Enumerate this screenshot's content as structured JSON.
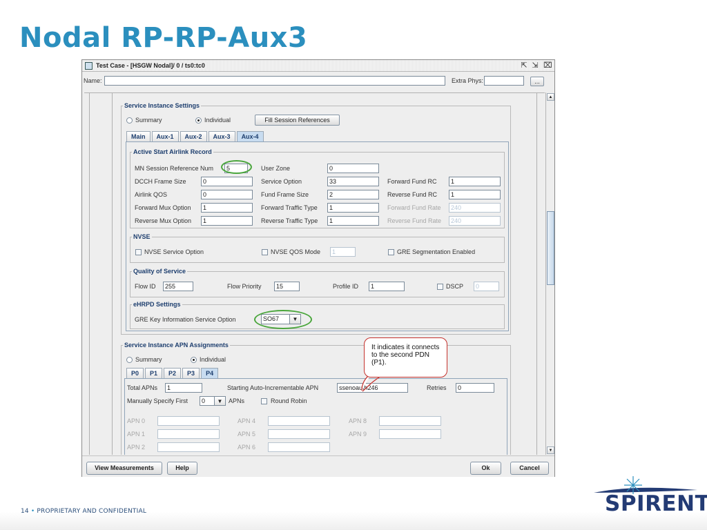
{
  "slide": {
    "title": "Nodal RP-RP-Aux3",
    "footer_page": "14",
    "footer_text": "PROPRIETARY AND CONFIDENTIAL",
    "logo_text": "SPIRENT"
  },
  "window": {
    "title": "Test Case - [HSGW Nodal]/ 0 / ts0:tc0",
    "name_label": "Name:",
    "name_value": "",
    "extra_phys_label": "Extra Phys:",
    "extra_phys_value": "",
    "browse_label": "..."
  },
  "service_instance": {
    "title": "Service Instance Settings",
    "summary_label": "Summary",
    "individual_label": "Individual",
    "selected": "Individual",
    "fill_button": "Fill Session References",
    "tabs": [
      "Main",
      "Aux-1",
      "Aux-2",
      "Aux-3",
      "Aux-4"
    ],
    "active_tab": "Aux-4"
  },
  "airlink": {
    "title": "Active Start Airlink Record",
    "col1": [
      {
        "label": "MN Session Reference Num",
        "value": "5"
      },
      {
        "label": "DCCH Frame Size",
        "value": "0"
      },
      {
        "label": "Airlink QOS",
        "value": "0"
      },
      {
        "label": "Forward Mux Option",
        "value": "1"
      },
      {
        "label": "Reverse Mux Option",
        "value": "1"
      }
    ],
    "col2": [
      {
        "label": "User Zone",
        "value": "0"
      },
      {
        "label": "Service Option",
        "value": "33"
      },
      {
        "label": "Fund Frame Size",
        "value": "2"
      },
      {
        "label": "Forward Traffic Type",
        "value": "1"
      },
      {
        "label": "Reverse Traffic Type",
        "value": "1"
      }
    ],
    "col3": [
      {
        "label": "Forward Fund RC",
        "value": "1",
        "disabled": false
      },
      {
        "label": "Reverse Fund RC",
        "value": "1",
        "disabled": false
      },
      {
        "label": "Forward Fund Rate",
        "value": "240",
        "disabled": true
      },
      {
        "label": "Reverse Fund Rate",
        "value": "240",
        "disabled": true
      }
    ]
  },
  "nvse": {
    "title": "NVSE",
    "service_option_label": "NVSE Service Option",
    "qos_mode_label": "NVSE QOS Mode",
    "qos_mode_value": "1",
    "gre_seg_label": "GRE Segmentation Enabled"
  },
  "qos": {
    "title": "Quality of Service",
    "flow_id_label": "Flow ID",
    "flow_id_value": "255",
    "flow_priority_label": "Flow Priority",
    "flow_priority_value": "15",
    "profile_id_label": "Profile ID",
    "profile_id_value": "1",
    "dscp_label": "DSCP",
    "dscp_value": "0"
  },
  "ehrpd": {
    "title": "eHRPD Settings",
    "gre_key_label": "GRE Key Information Service Option",
    "gre_key_value": "SO67"
  },
  "apn": {
    "title": "Service Instance APN Assignments",
    "summary_label": "Summary",
    "individual_label": "Individual",
    "tabs": [
      "P0",
      "P1",
      "P2",
      "P3",
      "P4"
    ],
    "active_tab": "P4",
    "total_apns_label": "Total APNs",
    "total_apns_value": "1",
    "starting_label": "Starting Auto-Incrementable APN",
    "starting_value": "ssenoauth246",
    "retries_label": "Retries",
    "retries_value": "0",
    "manual_label": "Manually Specify First",
    "manual_value": "0",
    "apns_label": "APNs",
    "round_robin_label": "Round Robin",
    "apn_labels": [
      "APN 0",
      "APN 1",
      "APN 2",
      "APN 4",
      "APN 5",
      "APN 6",
      "APN 8",
      "APN 9"
    ]
  },
  "callout": {
    "text": "It indicates it connects to the second PDN (P1)."
  },
  "buttons": {
    "view_measurements": "View Measurements",
    "help": "Help",
    "ok": "Ok",
    "cancel": "Cancel"
  },
  "colors": {
    "title_blue": "#2b8fbe",
    "highlight_green": "#4aa63c",
    "callout_red": "#c4302b"
  }
}
